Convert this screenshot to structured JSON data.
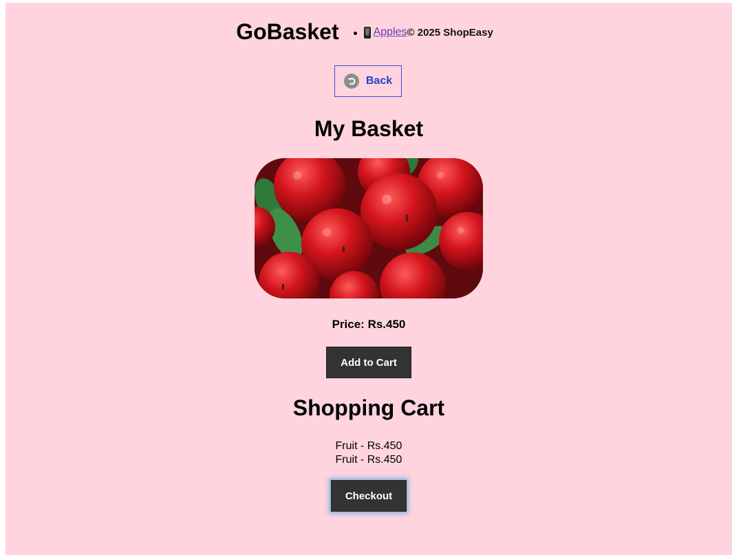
{
  "header": {
    "brand": "GoBasket",
    "nav_link_label": "Apples",
    "copyright": "© 2025 ShopEasy"
  },
  "back_button": {
    "label": "Back",
    "icon": "back-arrow-icon"
  },
  "basket": {
    "title": "My Basket",
    "product_image": "apples-image",
    "price_text": "Price: Rs.450",
    "add_to_cart_label": "Add to Cart"
  },
  "cart": {
    "title": "Shopping Cart",
    "items": [
      "Fruit - Rs.450",
      "Fruit - Rs.450"
    ],
    "checkout_label": "Checkout"
  },
  "colors": {
    "page_background": "#ffd4de",
    "button_dark": "#333333",
    "back_text": "#2240c8",
    "link": "#6a3bb4"
  }
}
